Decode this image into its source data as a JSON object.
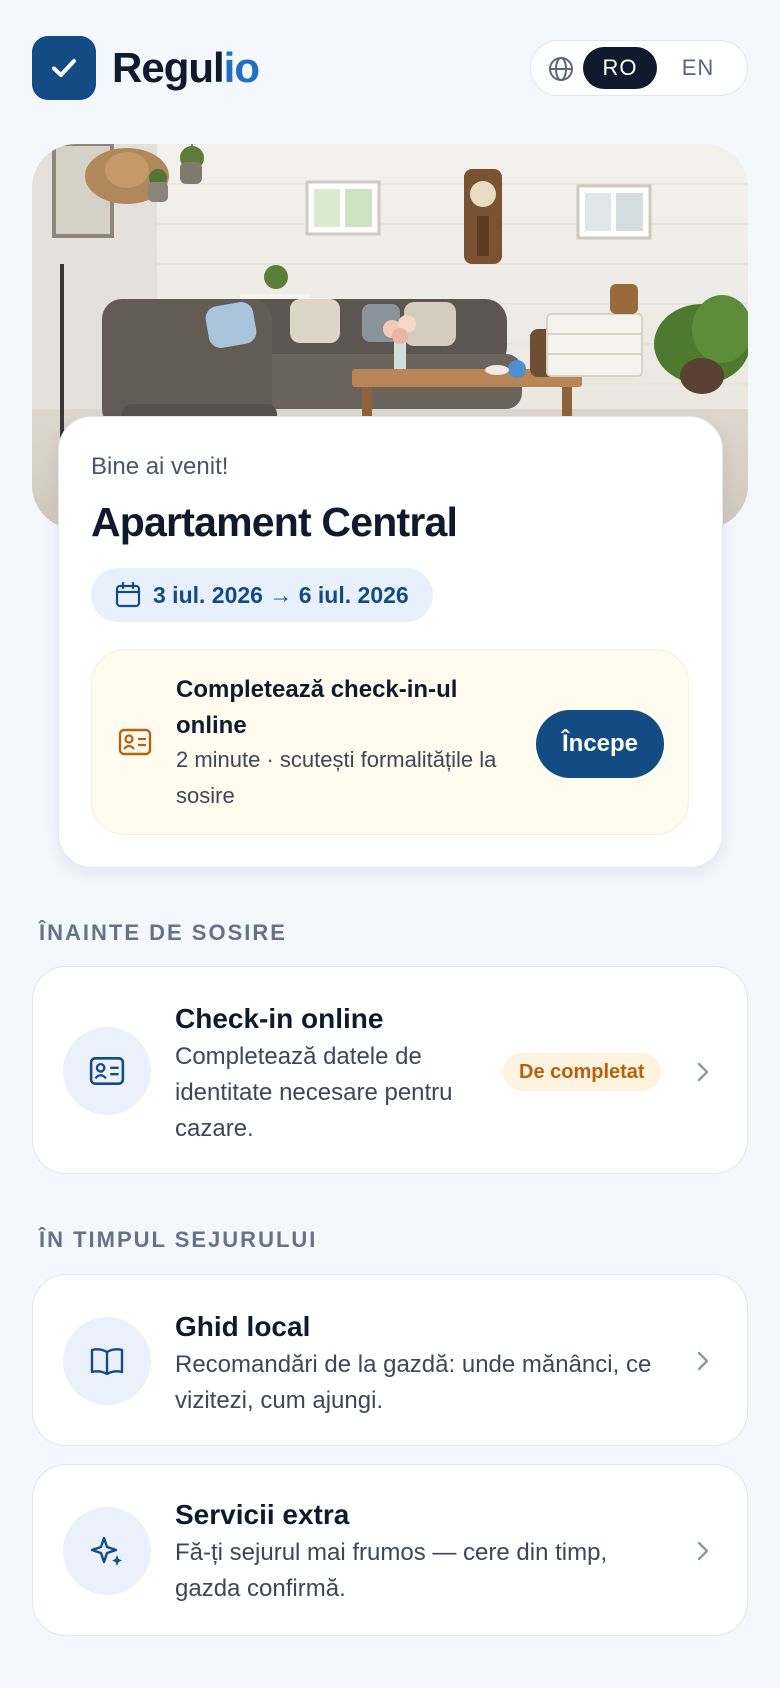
{
  "header": {
    "brand_main": "Regul",
    "brand_accent": "io",
    "languages": [
      "RO",
      "EN"
    ],
    "active_language": "RO"
  },
  "welcome": {
    "greeting": "Bine ai venit!",
    "property_name": "Apartament Central",
    "dates": "3 iul. 2026 → 6 iul. 2026"
  },
  "checkin_banner": {
    "title": "Completează check-in-ul online",
    "subtitle": "2 minute · scutești formalitățile la sosire",
    "button": "Începe"
  },
  "sections": {
    "before_arrival": "ÎNAINTE DE SOSIRE",
    "during_stay": "ÎN TIMPUL SEJURULUI"
  },
  "items": [
    {
      "title": "Check-in online",
      "description": "Completează datele de identitate necesare pentru cazare.",
      "badge": "De completat",
      "icon": "id-card-icon"
    },
    {
      "title": "Ghid local",
      "description": "Recomandări de la gazdă: unde mănânci, ce vizitezi, cum ajungi.",
      "icon": "book-icon"
    },
    {
      "title": "Servicii extra",
      "description": "Fă-ți sejurul mai frumos — cere din timp, gazda confirmă.",
      "icon": "sparkle-icon"
    }
  ],
  "colors": {
    "brand": "#134b84",
    "accent": "#1e6fc5",
    "background": "#f4f7fc",
    "badge_text": "#b5620e",
    "banner_bg": "#fffbef"
  }
}
